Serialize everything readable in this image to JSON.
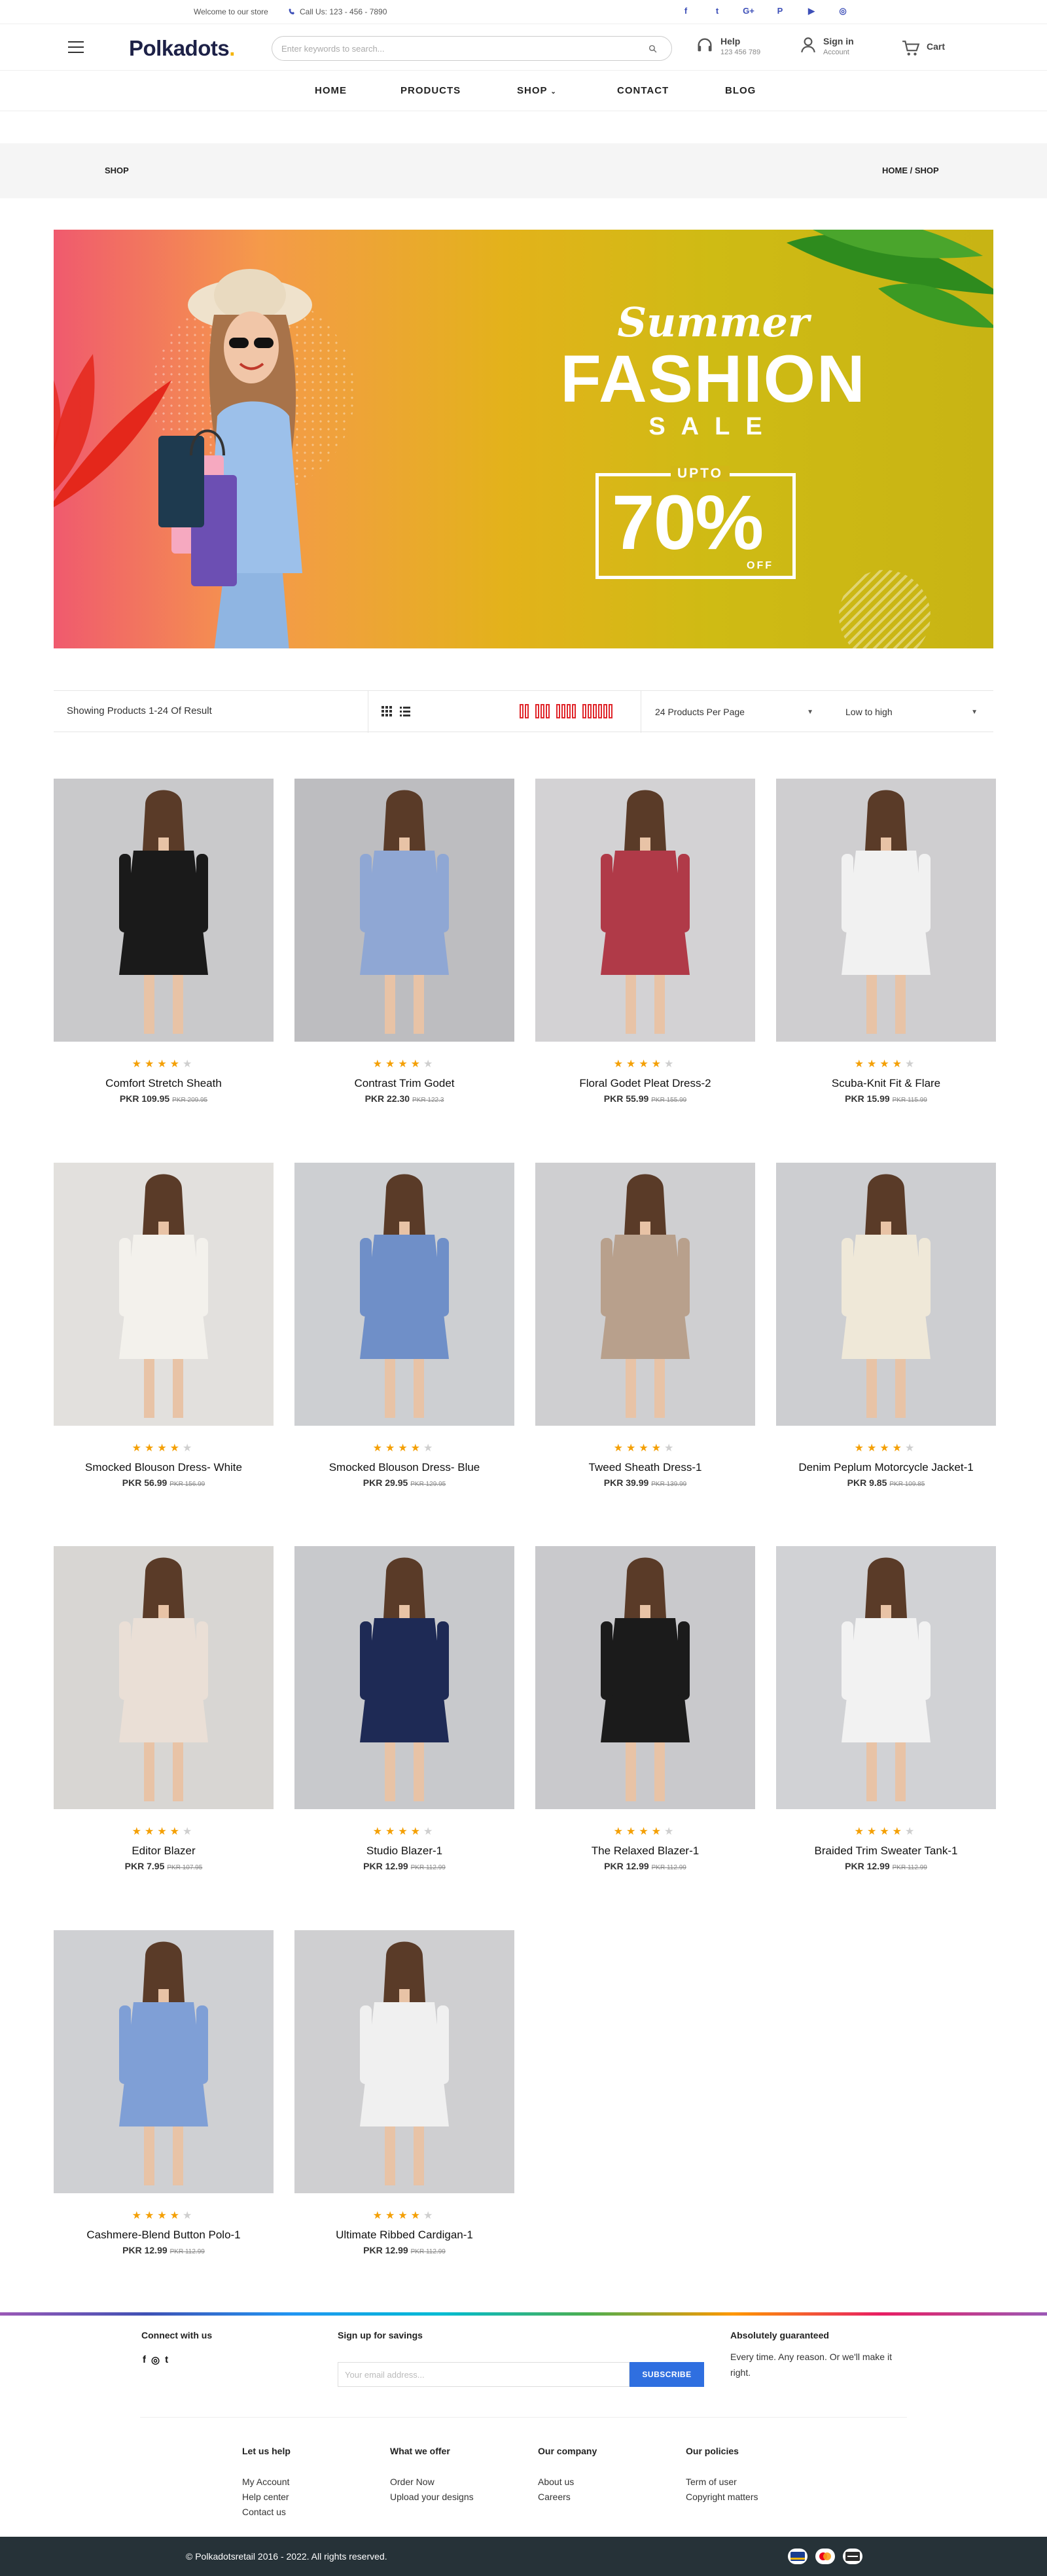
{
  "topbar": {
    "welcome": "Welcome to our store",
    "call": "Call Us: 123 - 456 - 7890",
    "socials": [
      "facebook-icon",
      "twitter-icon",
      "google-plus-icon",
      "pinterest-icon",
      "youtube-icon",
      "instagram-icon"
    ]
  },
  "header": {
    "logo_text": "Polkadots",
    "logo_dot": ".",
    "search_placeholder": "Enter keywords to search...",
    "help": {
      "title": "Help",
      "sub": "123 456 789"
    },
    "signin": {
      "title": "Sign in",
      "sub": "Account"
    },
    "cart": "Cart"
  },
  "nav": {
    "items": [
      "HOME",
      "PRODUCTS",
      "SHOP",
      "CONTACT",
      "BLOG"
    ]
  },
  "breadcrumb": {
    "left": "SHOP",
    "right": "HOME / SHOP"
  },
  "banner": {
    "line1": "Summer",
    "line2": "FASHION",
    "line3": "SALE",
    "upto": "UPTO",
    "percent": "70%",
    "off": "OFF"
  },
  "toolbar": {
    "showing": "Showing Products 1-24 Of Result",
    "per_page": "24 Products Per Page",
    "sort": "Low to high"
  },
  "products": [
    {
      "name": "Comfort Stretch Sheath",
      "price": "PKR 109.95",
      "old": "PKR 209.95",
      "rating": 4
    },
    {
      "name": "Contrast Trim Godet",
      "price": "PKR 22.30",
      "old": "PKR 122.3",
      "rating": 4
    },
    {
      "name": "Floral Godet Pleat Dress-2",
      "price": "PKR 55.99",
      "old": "PKR 155.99",
      "rating": 4
    },
    {
      "name": "Scuba-Knit Fit & Flare",
      "price": "PKR 15.99",
      "old": "PKR 115.99",
      "rating": 4
    },
    {
      "name": "Smocked Blouson Dress- White",
      "price": "PKR 56.99",
      "old": "PKR 156.99",
      "rating": 4
    },
    {
      "name": "Smocked Blouson Dress- Blue",
      "price": "PKR 29.95",
      "old": "PKR 129.95",
      "rating": 4
    },
    {
      "name": "Tweed Sheath Dress-1",
      "price": "PKR 39.99",
      "old": "PKR 139.99",
      "rating": 4
    },
    {
      "name": "Denim Peplum Motorcycle Jacket-1",
      "price": "PKR 9.85",
      "old": "PKR 109.85",
      "rating": 4
    },
    {
      "name": "Editor Blazer",
      "price": "PKR 7.95",
      "old": "PKR 107.95",
      "rating": 4
    },
    {
      "name": "Studio Blazer-1",
      "price": "PKR 12.99",
      "old": "PKR 112.99",
      "rating": 4
    },
    {
      "name": "The Relaxed Blazer-1",
      "price": "PKR 12.99",
      "old": "PKR 112.99",
      "rating": 4
    },
    {
      "name": "Braided Trim Sweater Tank-1",
      "price": "PKR 12.99",
      "old": "PKR 112.99",
      "rating": 4
    },
    {
      "name": "Cashmere-Blend Button Polo-1",
      "price": "PKR 12.99",
      "old": "PKR 112.99",
      "rating": 4
    },
    {
      "name": "Ultimate Ribbed Cardigan-1",
      "price": "PKR 12.99",
      "old": "PKR 112.99",
      "rating": 4
    }
  ],
  "footer": {
    "connect": "Connect with us",
    "signup": "Sign up for savings",
    "email_placeholder": "Your email address...",
    "subscribe": "SUBSCRIBE",
    "guarantee_title": "Absolutely guaranteed",
    "guarantee_text": "Every time. Any reason. Or we'll make it right.",
    "cols": [
      {
        "title": "Let us help",
        "links": [
          "My Account",
          "Help center",
          "Contact us"
        ]
      },
      {
        "title": "What we offer",
        "links": [
          "Order Now",
          "Upload your designs"
        ]
      },
      {
        "title": "Our company",
        "links": [
          "About us",
          "Careers"
        ]
      },
      {
        "title": "Our policies",
        "links": [
          "Term of user",
          "Copyright matters"
        ]
      }
    ],
    "copyright": "© Polkadotsretail 2016 - 2022. All rights reserved."
  }
}
